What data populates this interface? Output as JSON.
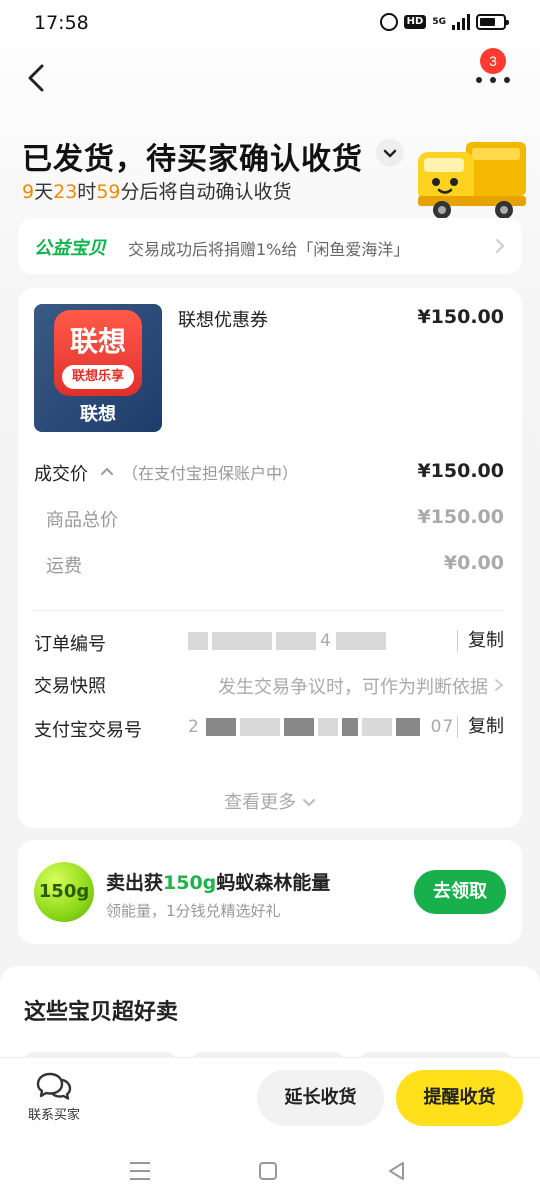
{
  "status_bar": {
    "time": "17:58",
    "hd": "HD",
    "network": "5G"
  },
  "nav": {
    "badge_count": "3"
  },
  "header": {
    "title": "已发货，待买家确认收货",
    "countdown": {
      "days": "9",
      "days_unit": "天",
      "hours": "23",
      "hours_unit": "时",
      "minutes": "59",
      "suffix": "分后将自动确认收货"
    }
  },
  "charity": {
    "brand": "公益宝贝",
    "text": "交易成功后将捐赠1%给「闲鱼爱海洋」"
  },
  "product": {
    "logo_main": "联想",
    "logo_pill": "联想乐享",
    "logo_caption": "联想",
    "name": "联想优惠券",
    "price": "¥150.00"
  },
  "pricing": {
    "deal_label": "成交价",
    "deal_note": "（在支付宝担保账户中）",
    "deal_value": "¥150.00",
    "goods_total_label": "商品总价",
    "goods_total_value": "¥150.00",
    "shipping_label": "运费",
    "shipping_value": "¥0.00"
  },
  "info": {
    "order_no_label": "订单编号",
    "order_no_value": "4",
    "copy_label": "复制",
    "snapshot_label": "交易快照",
    "snapshot_hint": "发生交易争议时，可作为判断依据",
    "alipay_no_label": "支付宝交易号",
    "alipay_no_prefix": "2",
    "alipay_no_suffix": "07",
    "copy_label_2": "复制"
  },
  "see_more": "查看更多",
  "energy": {
    "ball_text": "150g",
    "title_prefix": "卖出获",
    "title_highlight": "150g",
    "title_suffix": "蚂蚁森林能量",
    "subtitle": "领能量，1分钱兑精选好礼",
    "button": "去领取"
  },
  "recommend": {
    "title": "这些宝贝超好卖"
  },
  "actions": {
    "contact_label": "联系买家",
    "extend_label": "延长收货",
    "remind_label": "提醒收货"
  },
  "colors": {
    "accent_yellow": "#ffe01b",
    "green": "#18b04c",
    "countdown_orange": "#f08a00",
    "badge_red": "#ff3b30"
  }
}
